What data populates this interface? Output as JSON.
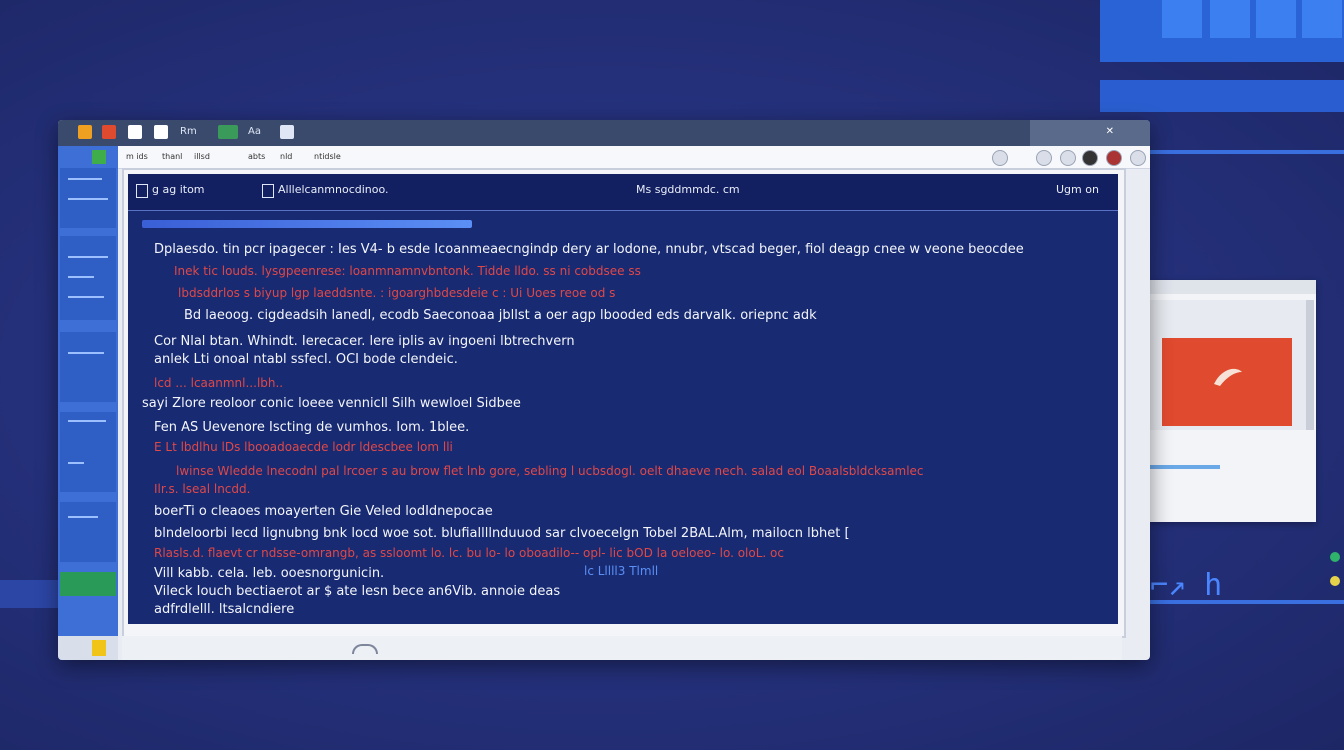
{
  "window": {
    "title_items": [
      "Rm",
      "Aa"
    ],
    "menu": [
      "m ids",
      "thanl",
      "illsd",
      "abts",
      "nld",
      "ntidsle"
    ]
  },
  "document": {
    "header_left": "g ag itom",
    "header_doc": "Alllelcanmnocdinoo.",
    "header_center": "Ms sgddmmdc. cm",
    "header_right": "Ugm on",
    "lines": [
      {
        "text": "Dplaesdo. tin pcr ipagecer  : Ies V4-  b esde Icoanmeaecngindp dery  ar lodone,  nnubr,  vtscad beger,  fiol  deagp  cnee  w veone  beocdee",
        "color": "w"
      },
      {
        "text": "Inek tic louds. lysgpeenrese: loanmnamnvbntonk. Tidde lldo. ss ni cobdsee ss",
        "color": "r"
      },
      {
        "text": "lbdsddrlos s   biyup lgp laeddsnte. : igoarghbdesdeie c  :  Ui  Uoes reoe od s",
        "color": "r"
      },
      {
        "text": "Bd laeoog. cigdeadsih lanedl,  ecodb Saeconoaa jbllst a oer  agp lbooded eds darvalk. oriepnc adk",
        "color": "w"
      },
      {
        "text": "Cor Nlal btan. Whindt.  Ierecacer. lere iplis av ingoeni lbtrechvern",
        "color": "w"
      },
      {
        "text": "anlek Lti onoal ntabl ssfecl.  OCI bode clendeic.",
        "color": "w"
      },
      {
        "text": "lcd ... lcaanmnl...lbh..",
        "color": "r"
      },
      {
        "text": "sayi  Zlore reoloor conic  loeee vennicll  Silh wewloel Sidbee",
        "color": "w"
      },
      {
        "text": "Fen AS Uevenore Iscting de vumhos. Iom. 1blee.",
        "color": "w"
      },
      {
        "text": "E Lt lbdlhu lDs  lbooadoaecde  lodr ldescbee  lom  lli",
        "color": "r"
      },
      {
        "text": "lwinse Wledde lnecodnl pal lrcoer  s au brow flet lnb gore,  sebling l ucbsdogl. oelt dhaeve nech.  salad eol  Boaalsbldcksamlec",
        "color": "r"
      },
      {
        "text": "Ilr.s. lseal lncdd.",
        "color": "r"
      },
      {
        "text": "boerTi  o cleaoes moayerten  Gie Veled  lodIdnepocae",
        "color": "w"
      },
      {
        "text": "blndeloorbi lecd lignubng  bnk  locd woe sot. blufiallllnduuod sar  clvoecelgn  Tobel  2BAL.Alm,  mailocn lbhet [",
        "color": "w"
      },
      {
        "text": "Rlasls.d. flaevt cr ndsse-omrangb,  as ssloomt lo. lc. bu lo- lo oboadilo-- opl-  lic  bOD la oeloeo-  lo. oloL. oc",
        "color": "r"
      },
      {
        "text": "Vill kabb.  cela. leb. ooesnorgunicin.",
        "color": "w"
      },
      {
        "text": "Vileck  Iouch  bectiaerot ar   $ ate lesn bece an6Vib.  annoie  deas",
        "color": "w"
      },
      {
        "text": "adfrdlelll. ltsalcndiere",
        "color": "w"
      }
    ],
    "inline_link": "lc Lllll3 Tlmll"
  },
  "colors": {
    "doc_bg": "#172a72",
    "red_text": "#e04848",
    "accent": "#3b7ff0"
  }
}
